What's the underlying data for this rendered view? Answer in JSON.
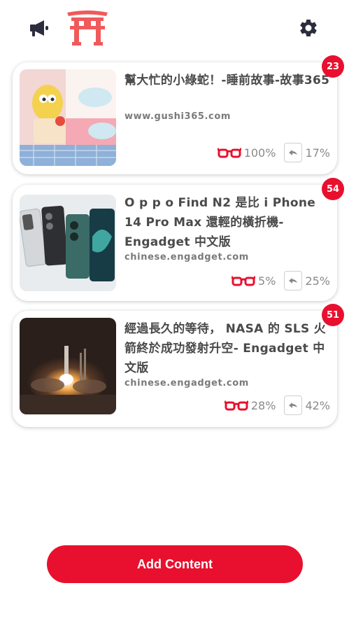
{
  "header": {
    "left_icon": "megaphone-icon",
    "logo_icon": "torii-gate-icon",
    "right_icon": "gear-icon"
  },
  "colors": {
    "accent": "#e8102e",
    "text": "#4a4a4a",
    "muted": "#8a8a8a"
  },
  "cards": [
    {
      "title": "幫大忙的小綠蛇！-睡前故事-故事365",
      "domain": "www.gushi365.com",
      "read": "100%",
      "share": "17%",
      "badge": "23"
    },
    {
      "title": "O p p o Find N2 是比 i Phone 14 Pro Max 還輕的橫折機- Engadget 中文版",
      "domain": "chinese.engadget.com",
      "read": "5%",
      "share": "25%",
      "badge": "54"
    },
    {
      "title": "經過長久的等待， NASA 的 SLS 火箭終於成功發射升空- Engadget 中文版",
      "domain": "chinese.engadget.com",
      "read": "28%",
      "share": "42%",
      "badge": "51"
    }
  ],
  "add_button": {
    "label": "Add Content"
  }
}
